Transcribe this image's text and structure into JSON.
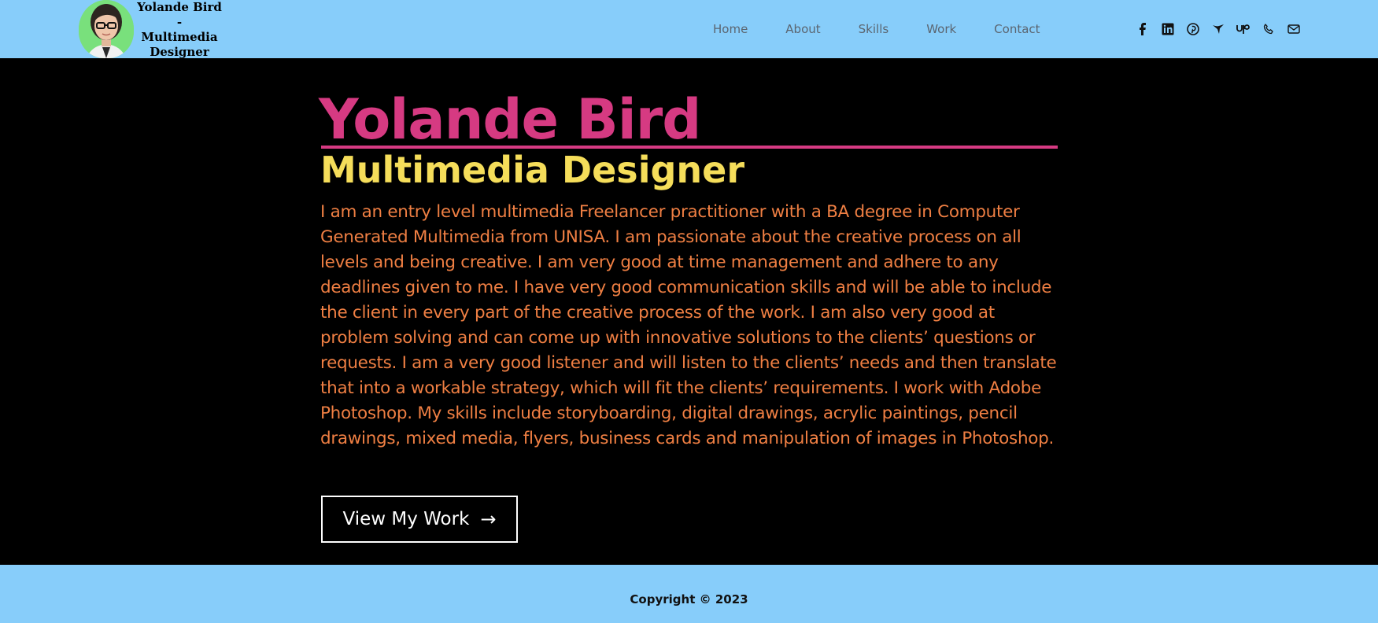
{
  "header": {
    "logo_lines": [
      "Yolande Bird",
      "-",
      "Multimedia",
      "Designer"
    ],
    "nav": [
      "Home",
      "About",
      "Skills",
      "Work",
      "Contact"
    ],
    "social_icons": [
      "facebook-icon",
      "linkedin-icon",
      "pinterest-icon",
      "fiverr-icon",
      "upwork-icon",
      "phone-icon",
      "email-icon"
    ]
  },
  "hero": {
    "name": "Yolande Bird",
    "role": "Multimedia Designer",
    "bio": "I am an entry level multimedia Freelancer practitioner with a BA degree in Computer Generated Multimedia from UNISA. I am passionate about the creative process on all levels and being creative. I am very good at time management and adhere to any deadlines given to me. I have very good communication skills and will be able to include the client in every part of the creative process of the work. I am also very good at problem solving and can come up with innovative solutions to the clients’ questions or requests. I am a very good listener and will listen to the clients’ needs and then translate that into a workable strategy, which will fit the clients’ requirements. I work with Adobe Photoshop. My skills include storyboarding, digital drawings, acrylic paintings, pencil drawings, mixed media, flyers, business cards and manipulation of images in Photoshop.",
    "cta_label": "View My Work",
    "cta_arrow": "→"
  },
  "footer": {
    "copyright": "Copyright © 2023"
  },
  "colors": {
    "header_bg": "#87cdfa",
    "hero_bg": "#000000",
    "name": "#d63a82",
    "role": "#f5dd5a",
    "bio": "#ef7f43",
    "avatar_bg": "#79e07c"
  }
}
